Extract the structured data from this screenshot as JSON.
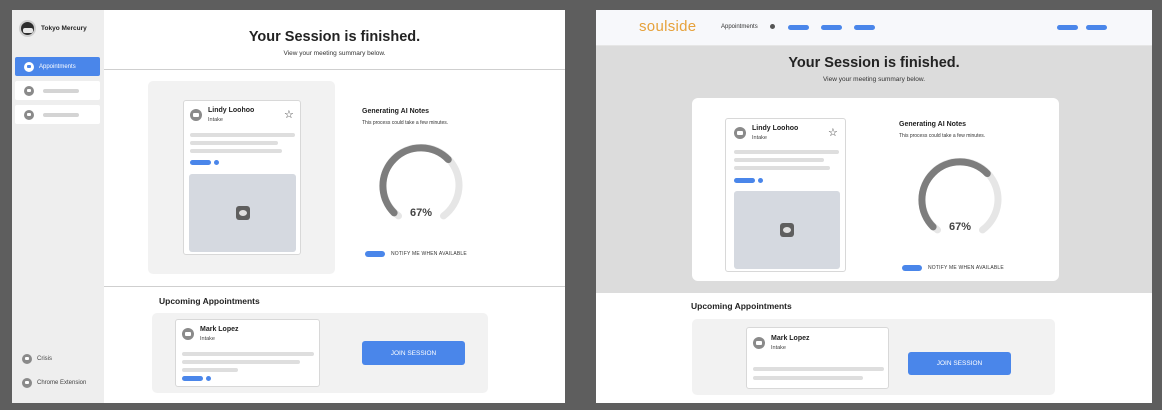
{
  "frame1": {
    "sidebar": {
      "user_name": "Tokyo Mercury",
      "items": [
        {
          "label": "Appointments",
          "active": true
        }
      ],
      "bottom_items": [
        {
          "label": "Crisis",
          "icon": "user-icon"
        },
        {
          "label": "Chrome Extension",
          "icon": "user-icon"
        }
      ]
    },
    "header": {
      "title": "Your Session is finished.",
      "subtitle": "View your meeting summary below."
    },
    "profile": {
      "name": "Lindy Loohoo",
      "tag": "Intake"
    },
    "ai_notes": {
      "title": "Generating AI Notes",
      "subtitle": "This process could take a few minutes.",
      "progress": 67,
      "progress_label": "67%",
      "notify_label": "NOTIFY ME WHEN AVAILABLE"
    },
    "upcoming": {
      "title": "Upcoming Appointments",
      "name": "Mark Lopez",
      "tag": "Intake",
      "button": "JOIN SESSION"
    }
  },
  "frame2": {
    "logo": "soulside",
    "nav_link": "Appointments",
    "header": {
      "title": "Your Session is finished.",
      "subtitle": "View your meeting summary below."
    },
    "profile": {
      "name": "Lindy Loohoo",
      "tag": "Intake"
    },
    "ai_notes": {
      "title": "Generating AI Notes",
      "subtitle": "This process could take a few minutes.",
      "progress": 67,
      "progress_label": "67%",
      "notify_label": "NOTIFY ME WHEN AVAILABLE"
    },
    "upcoming": {
      "title": "Upcoming Appointments",
      "name": "Mark Lopez",
      "tag": "Intake",
      "button": "JOIN SESSION"
    }
  },
  "colors": {
    "accent": "#4a86ea",
    "logo": "#e6a13a",
    "gauge_fill": "#7d7d7d",
    "gauge_track": "#e6e6e6"
  }
}
